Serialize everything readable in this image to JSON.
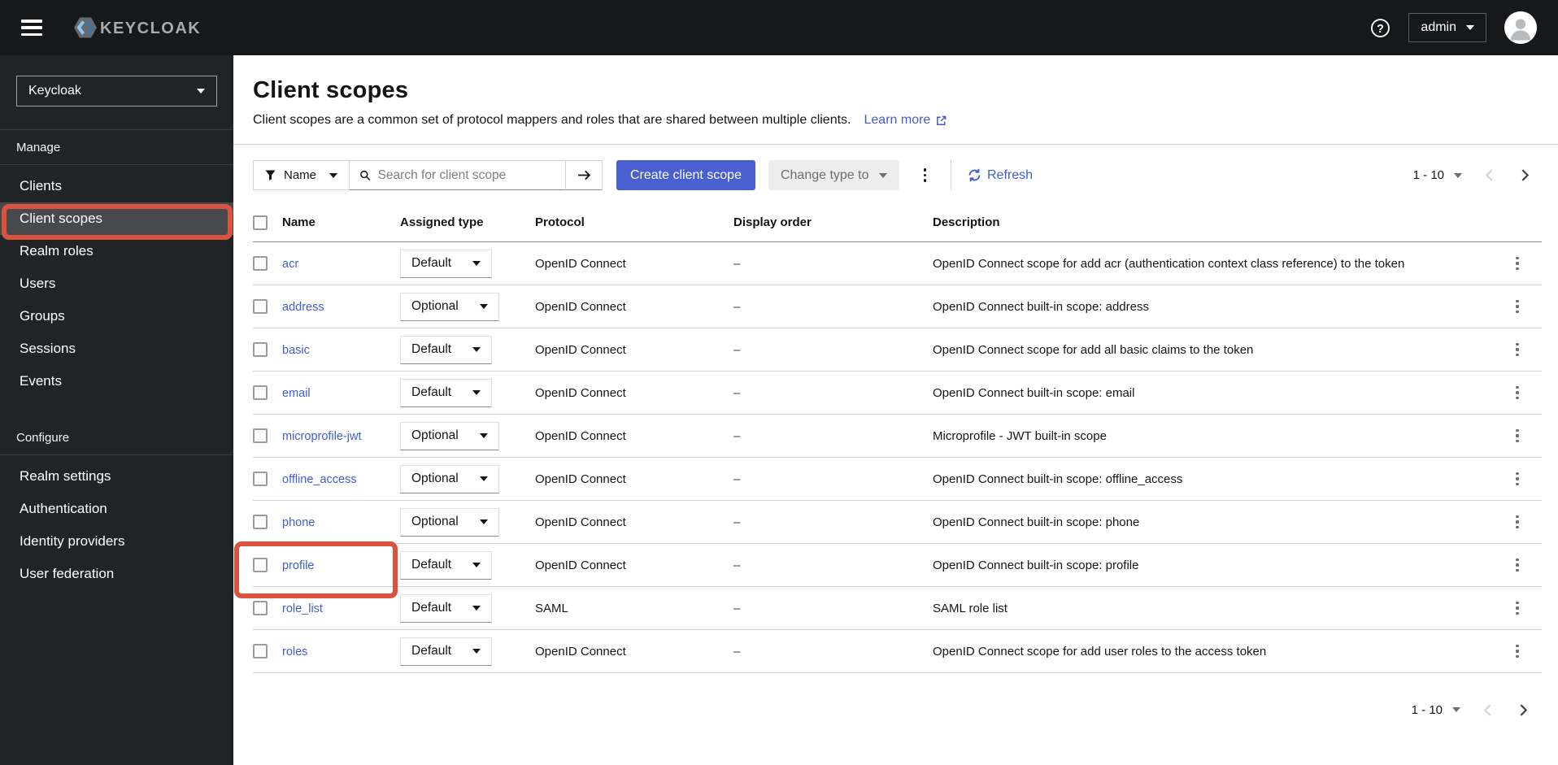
{
  "colors": {
    "masthead": "#16181a",
    "sidebar": "#212427",
    "sidebar_selected": "#47494d",
    "accent": "#4a5fd0",
    "link": "#3f5ed1",
    "annotation": "#d9533f"
  },
  "masthead": {
    "brand_text": "KEYCLOAK",
    "user_menu_label": "admin"
  },
  "sidebar": {
    "realm_selector_value": "Keycloak",
    "sections": [
      {
        "label": "Manage",
        "items": [
          {
            "label": "Clients",
            "selected": false
          },
          {
            "label": "Client scopes",
            "selected": true
          },
          {
            "label": "Realm roles",
            "selected": false
          },
          {
            "label": "Users",
            "selected": false
          },
          {
            "label": "Groups",
            "selected": false
          },
          {
            "label": "Sessions",
            "selected": false
          },
          {
            "label": "Events",
            "selected": false
          }
        ]
      },
      {
        "label": "Configure",
        "items": [
          {
            "label": "Realm settings",
            "selected": false
          },
          {
            "label": "Authentication",
            "selected": false
          },
          {
            "label": "Identity providers",
            "selected": false
          },
          {
            "label": "User federation",
            "selected": false
          }
        ]
      }
    ]
  },
  "page": {
    "title": "Client scopes",
    "description": "Client scopes are a common set of protocol mappers and roles that are shared between multiple clients.",
    "learn_more_label": "Learn more"
  },
  "toolbar": {
    "filter_label": "Name",
    "search_placeholder": "Search for client scope",
    "create_button_label": "Create client scope",
    "change_type_label": "Change type to",
    "refresh_label": "Refresh",
    "pagination_range": "1 - 10"
  },
  "table": {
    "columns": [
      "Name",
      "Assigned type",
      "Protocol",
      "Display order",
      "Description"
    ],
    "rows": [
      {
        "name": "acr",
        "assigned_type": "Default",
        "protocol": "OpenID Connect",
        "display_order": "–",
        "description": "OpenID Connect scope for add acr (authentication context class reference) to the token",
        "annotated": false
      },
      {
        "name": "address",
        "assigned_type": "Optional",
        "protocol": "OpenID Connect",
        "display_order": "–",
        "description": "OpenID Connect built-in scope: address",
        "annotated": false
      },
      {
        "name": "basic",
        "assigned_type": "Default",
        "protocol": "OpenID Connect",
        "display_order": "–",
        "description": "OpenID Connect scope for add all basic claims to the token",
        "annotated": false
      },
      {
        "name": "email",
        "assigned_type": "Default",
        "protocol": "OpenID Connect",
        "display_order": "–",
        "description": "OpenID Connect built-in scope: email",
        "annotated": false
      },
      {
        "name": "microprofile-jwt",
        "assigned_type": "Optional",
        "protocol": "OpenID Connect",
        "display_order": "–",
        "description": "Microprofile - JWT built-in scope",
        "annotated": false
      },
      {
        "name": "offline_access",
        "assigned_type": "Optional",
        "protocol": "OpenID Connect",
        "display_order": "–",
        "description": "OpenID Connect built-in scope: offline_access",
        "annotated": false
      },
      {
        "name": "phone",
        "assigned_type": "Optional",
        "protocol": "OpenID Connect",
        "display_order": "–",
        "description": "OpenID Connect built-in scope: phone",
        "annotated": false
      },
      {
        "name": "profile",
        "assigned_type": "Default",
        "protocol": "OpenID Connect",
        "display_order": "–",
        "description": "OpenID Connect built-in scope: profile",
        "annotated": true
      },
      {
        "name": "role_list",
        "assigned_type": "Default",
        "protocol": "SAML",
        "display_order": "–",
        "description": "SAML role list",
        "annotated": false
      },
      {
        "name": "roles",
        "assigned_type": "Default",
        "protocol": "OpenID Connect",
        "display_order": "–",
        "description": "OpenID Connect scope for add user roles to the access token",
        "annotated": false
      }
    ]
  },
  "bottom_pagination_range": "1 - 10"
}
